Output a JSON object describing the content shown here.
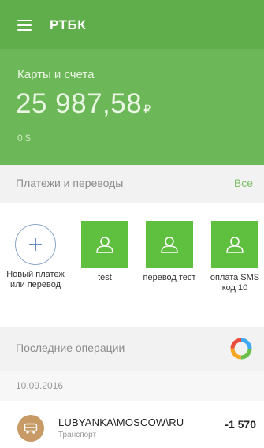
{
  "header": {
    "app_title": "РТБК",
    "accounts_label": "Карты и счета",
    "balance_main": "25 987,58",
    "balance_currency": "₽",
    "balance_usd": "0 $"
  },
  "payments": {
    "section_label": "Платежи и переводы",
    "all_link": "Все",
    "items": [
      {
        "label": "Новый платеж или перевод",
        "icon": "plus-icon"
      },
      {
        "label": "test",
        "icon": "user-icon"
      },
      {
        "label": "перевод тест",
        "icon": "user-icon"
      },
      {
        "label": "оплата SMS код 10",
        "icon": "user-icon"
      }
    ]
  },
  "recent": {
    "section_label": "Последние операции",
    "date": "10.09.2016",
    "operations": [
      {
        "title": "LUBYANKA\\MOSCOW\\RU",
        "category": "Транспорт",
        "amount": "-1 570",
        "icon": "transport-icon"
      }
    ]
  },
  "colors": {
    "header_green": "#6cb858",
    "tile_green": "#5fbf3f",
    "link_green": "#7fbf6a",
    "donut": [
      "#f5a623",
      "#e94e3c",
      "#3fa9f5",
      "#6cc04a"
    ]
  }
}
